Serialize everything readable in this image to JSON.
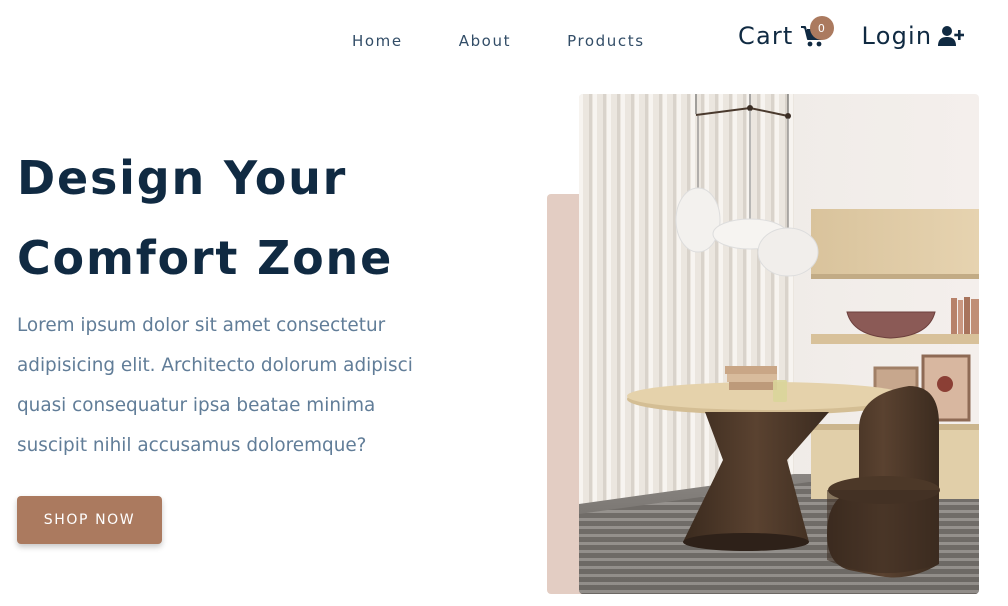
{
  "nav": {
    "links": [
      "Home",
      "About",
      "Products"
    ],
    "cart_label": "Cart",
    "cart_count": "0",
    "login_label": "Login"
  },
  "hero": {
    "title_line1": "Design Your",
    "title_line2": "Comfort Zone",
    "text": "Lorem ipsum dolor sit amet consectetur adipisicing elit. Architecto dolorum adipisci quasi consequatur ipsa beatae minima suscipit nihil accusamus doloremque?",
    "button_label": "SHOP NOW"
  },
  "icons": {
    "cart": "shopping-cart-icon",
    "login": "user-plus-icon"
  },
  "colors": {
    "primary": "#ab7a5f",
    "heading": "#102a42",
    "text": "#617d98",
    "accent_block": "#e3cdc3"
  }
}
